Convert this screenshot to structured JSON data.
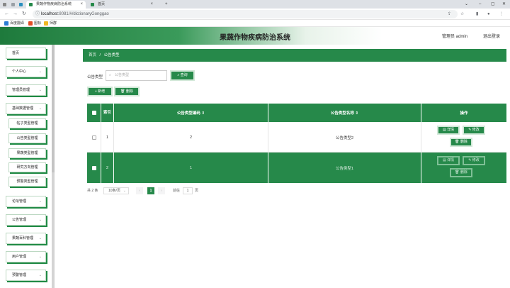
{
  "browser": {
    "tabs": [
      {
        "label": ""
      },
      {
        "label": ""
      },
      {
        "label": "果蔬作物疾病防治系统"
      },
      {
        "label": "首页"
      }
    ],
    "new_tab": "+",
    "url_host": "localhost",
    "url_path": ":8081/#/dictionaryGonggao",
    "bookmarks": [
      {
        "label": "百度翻译"
      },
      {
        "label": "图标"
      },
      {
        "label": "师群"
      }
    ]
  },
  "header": {
    "title": "果蔬作物疾病防治系统",
    "user": "管理员 admin",
    "logout": "退出登录"
  },
  "sidebar": {
    "menus": [
      {
        "label": "首页",
        "chevron": ""
      },
      {
        "label": "个人中心",
        "chevron": "⌄"
      },
      {
        "label": "管理员管理",
        "chevron": "⌄"
      },
      {
        "label": "基础数据管理",
        "chevron": "⌄"
      }
    ],
    "submenus": [
      {
        "label": "帖子类型管理"
      },
      {
        "label": "公告类型管理"
      },
      {
        "label": "果蔬类型管理"
      },
      {
        "label": "研究方向管理"
      },
      {
        "label": "预警类型管理"
      }
    ],
    "menus2": [
      {
        "label": "论坛管理",
        "chevron": "⌄"
      },
      {
        "label": "公告管理",
        "chevron": "⌄"
      },
      {
        "label": "果蔬百科管理",
        "chevron": "⌄"
      },
      {
        "label": "用户管理",
        "chevron": "⌄"
      },
      {
        "label": "预警管理",
        "chevron": "⌄"
      }
    ]
  },
  "breadcrumb": {
    "home": "首页",
    "sep": "/",
    "current": "公告类型"
  },
  "filter": {
    "label": "公告类型",
    "placeholder": "公告类型",
    "search_btn": "⌕ 查询"
  },
  "actions": {
    "add": "+ 新增",
    "delete": "🗑 删除"
  },
  "table": {
    "columns": [
      "",
      "索引",
      "公告类型编码 ⇕",
      "公告类型名称 ⇕",
      "操作"
    ],
    "rows": [
      {
        "index": "1",
        "code": "2",
        "name": "公告类型2"
      },
      {
        "index": "2",
        "code": "1",
        "name": "公告类型1"
      }
    ],
    "ops": {
      "detail": "▤ 详情",
      "edit": "✎ 修改",
      "delete": "🗑 删除"
    }
  },
  "pagination": {
    "total": "共 2 条",
    "page_size": "10条/页",
    "prev": "‹",
    "current": "1",
    "next": "›",
    "goto": "前往",
    "goto_value": "1",
    "page_unit": "页"
  }
}
